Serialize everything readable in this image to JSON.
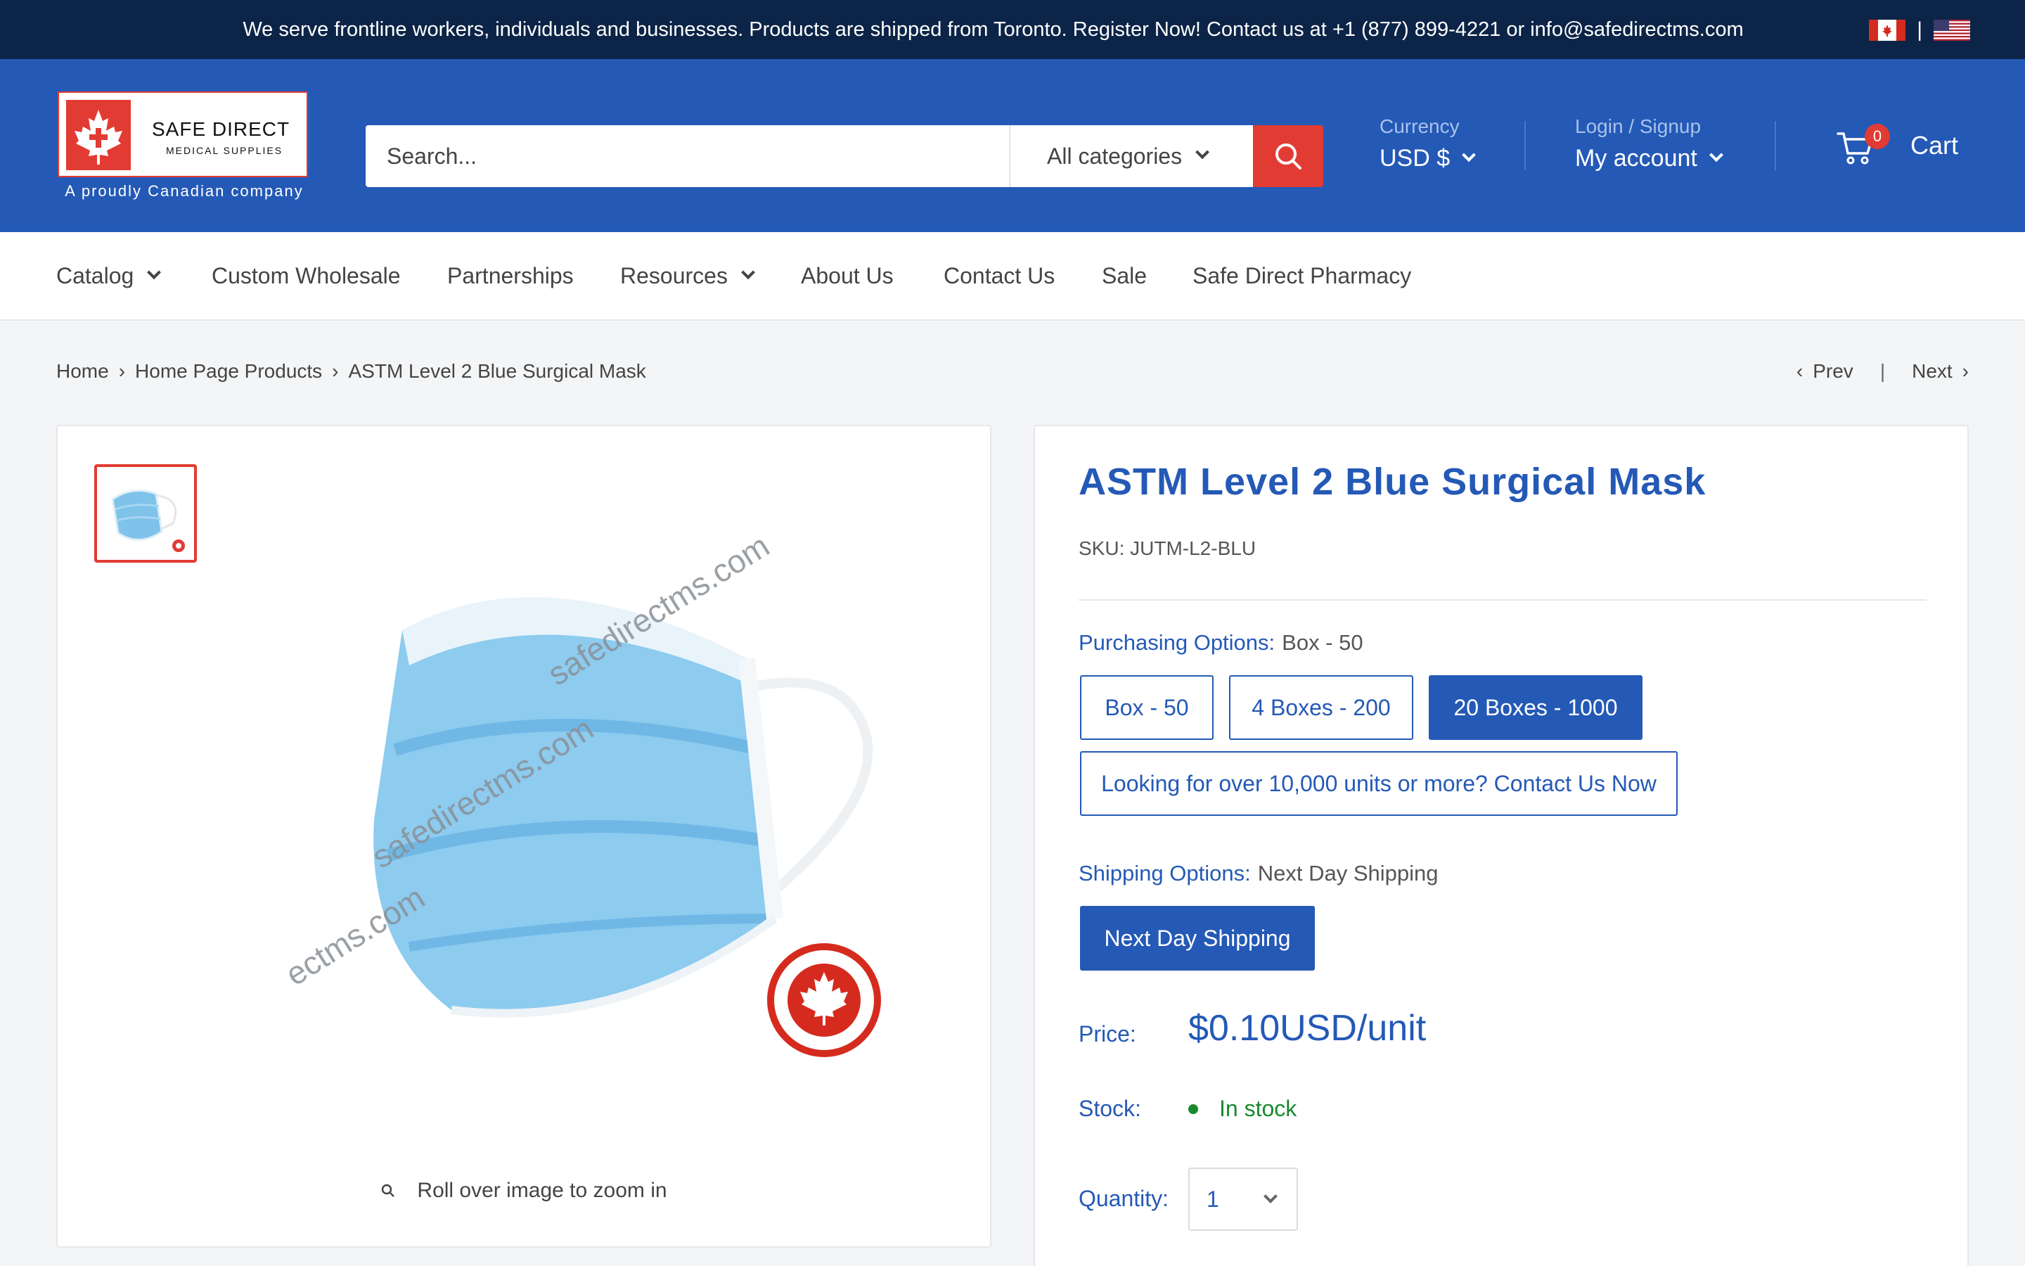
{
  "announcement": {
    "text": "We serve frontline workers, individuals and businesses. Products are shipped from Toronto. Register Now! Contact us at +1 (877) 899-4221 or info@safedirectms.com",
    "separator": "|"
  },
  "header": {
    "logo_name": "SAFE DIRECT",
    "logo_sub": "MEDICAL SUPPLIES",
    "logo_tagline": "A proudly Canadian company",
    "search_placeholder": "Search...",
    "category": "All categories",
    "currency_label": "Currency",
    "currency_value": "USD $",
    "login_label": "Login / Signup",
    "account_label": "My account",
    "cart_count": "0",
    "cart_label": "Cart"
  },
  "nav": {
    "items": [
      "Catalog",
      "Custom Wholesale",
      "Partnerships",
      "Resources",
      "About Us",
      "Contact Us",
      "Sale",
      "Safe Direct Pharmacy"
    ]
  },
  "breadcrumb": {
    "items": [
      "Home",
      "Home Page Products",
      "ASTM Level 2 Blue Surgical Mask"
    ],
    "prev": "Prev",
    "next": "Next"
  },
  "gallery": {
    "watermark": "safedirectms.com",
    "zoom_hint": "Roll over image to zoom in"
  },
  "product": {
    "title": "ASTM Level 2 Blue Surgical Mask",
    "sku": "SKU: JUTM-L2-BLU",
    "purchasing_label": "Purchasing Options:",
    "purchasing_selected": "Box - 50",
    "purchasing_options": [
      "Box - 50",
      "4 Boxes - 200",
      "20 Boxes - 1000"
    ],
    "bulk_contact": "Looking for over 10,000 units or more? Contact Us Now",
    "shipping_label": "Shipping Options:",
    "shipping_selected": "Next Day Shipping",
    "shipping_options": [
      "Next Day Shipping"
    ],
    "price_label": "Price:",
    "price": "$0.10USD/unit",
    "stock_label": "Stock:",
    "stock": "In stock",
    "quantity_label": "Quantity:",
    "quantity": "1"
  },
  "colors": {
    "brand_blue": "#2459b6",
    "announce_navy": "#0c2447",
    "accent_red": "#e23b33",
    "stock_green": "#188a2e"
  }
}
